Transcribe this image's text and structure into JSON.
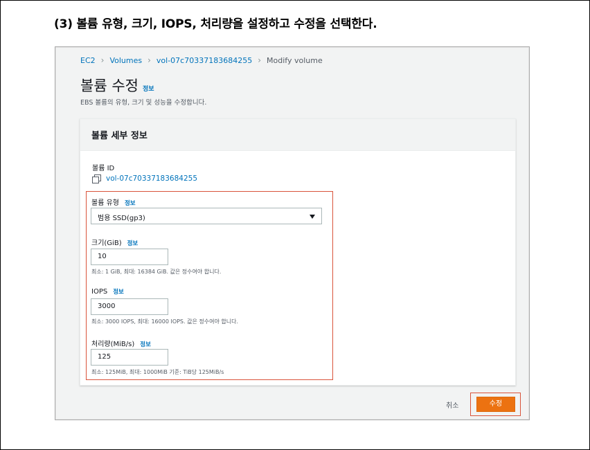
{
  "caption": "(3) 볼륨 유형, 크기, IOPS, 처리량을 설정하고 수정을 선택한다.",
  "breadcrumb": {
    "items": [
      "EC2",
      "Volumes",
      "vol-07c70337183684255"
    ],
    "current": "Modify volume"
  },
  "page": {
    "title": "볼륨 수정",
    "title_info": "정보",
    "description": "EBS 볼륨의 유형, 크기 및 성능을 수정합니다."
  },
  "panel": {
    "header": "볼륨 세부 정보",
    "volume_id_label": "볼륨 ID",
    "volume_id_value": "vol-07c70337183684255",
    "volume_type": {
      "label": "볼륨 유형",
      "info": "정보",
      "selected": "범용 SSD(gp3)"
    },
    "size": {
      "label": "크기(GiB)",
      "info": "정보",
      "value": "10",
      "hint": "최소: 1 GiB, 최대: 16384 GiB. 값은 정수여야 합니다."
    },
    "iops": {
      "label": "IOPS",
      "info": "정보",
      "value": "3000",
      "hint": "최소: 3000 IOPS, 최대: 16000 IOPS. 값은 정수여야 합니다."
    },
    "throughput": {
      "label": "처리량(MiB/s)",
      "info": "정보",
      "value": "125",
      "hint": "최소: 125MiB, 최대: 1000MiB 기준: TiB당 125MiB/s"
    }
  },
  "actions": {
    "cancel": "취소",
    "submit": "수정"
  },
  "colors": {
    "link": "#0073bb",
    "primary_button": "#ec7211",
    "highlight": "#d9533a"
  }
}
